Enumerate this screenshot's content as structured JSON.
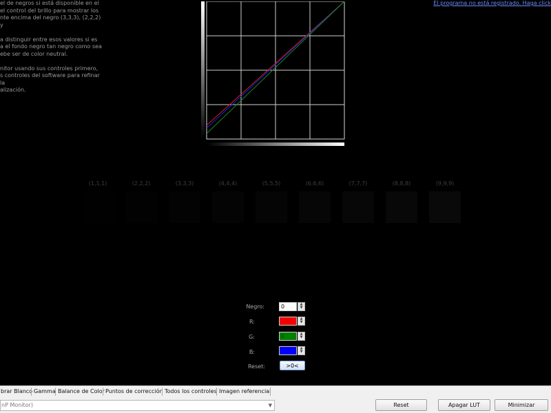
{
  "help": {
    "text": "el de negros si está disponible en el\nel control del brillo para mostrar los\nnte encima del negro (3,3,3), (2,2,2) y\n\na distinguir entre esos valores si es\na el fondo negro tan negro como sea\nebe ser de color neutral.\n\nnitor usando sus controles primero,\ns controles del software para refinar la\nalización."
  },
  "header": {
    "unregistered_link": "El programa no está registrado. Haga click"
  },
  "chart_data": {
    "type": "line",
    "title": "",
    "xlabel": "",
    "ylabel": "",
    "xlim": [
      0,
      1
    ],
    "ylim": [
      0,
      1
    ],
    "grid": true,
    "series": [
      {
        "color": "#d02020",
        "x": [
          0,
          1
        ],
        "y": [
          0.1,
          1.0
        ]
      },
      {
        "color": "#2020e0",
        "x": [
          0,
          1
        ],
        "y": [
          0.08,
          1.0
        ]
      },
      {
        "color": "#1a8a1a",
        "x": [
          0,
          1
        ],
        "y": [
          0.04,
          1.0
        ]
      }
    ]
  },
  "swatches": [
    {
      "label": "(1,1,1)",
      "color": "#010101"
    },
    {
      "label": "(2,2,2)",
      "color": "#020202"
    },
    {
      "label": "(3,3,3)",
      "color": "#030303"
    },
    {
      "label": "(4,4,4)",
      "color": "#040404"
    },
    {
      "label": "(5,5,5)",
      "color": "#050505"
    },
    {
      "label": "(6,6,6)",
      "color": "#060606"
    },
    {
      "label": "(7,7,7)",
      "color": "#070707"
    },
    {
      "label": "(8,8,8)",
      "color": "#080808"
    },
    {
      "label": "(9,9,9)",
      "color": "#090909"
    }
  ],
  "controls": {
    "negro_label": "Negro:",
    "negro_value": "0",
    "r_label": "R:",
    "r_value": "100",
    "r_color": "#ff0000",
    "g_label": "G:",
    "g_value": "0",
    "g_color": "#008000",
    "b_label": "B:",
    "b_value": "",
    "b_color": "#0000ff",
    "reset_label": "Reset:",
    "reset_button": ">0<"
  },
  "tabs": [
    "brar Blanco",
    "Gamma",
    "Balance de Color",
    "Puntos de corrección",
    "Todos los controles",
    "Imagen referencial"
  ],
  "footer": {
    "monitor_value": "nP Monitor)",
    "reset_button": "Reset",
    "lut_button": "Apagar LUT",
    "minimize_button": "Minimizar"
  }
}
